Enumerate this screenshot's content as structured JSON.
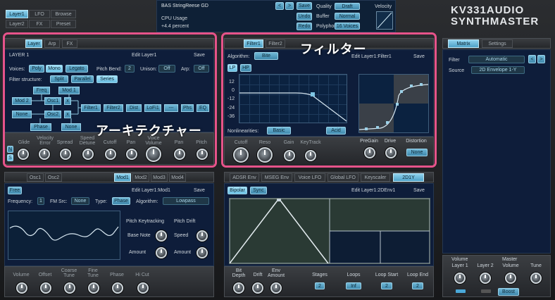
{
  "top": {
    "nav": [
      "Layer1",
      "LFO",
      "Browse",
      "Layer2",
      "FX",
      "Preset"
    ],
    "preset_name": "BAS StringReese GD",
    "cpu_label": "CPU Usage",
    "cpu_value": "+4.4 percent",
    "save": "Save",
    "undo": "Undo",
    "redo": "Redo",
    "quality_label": "Quality",
    "quality_value": "Draft",
    "buffer_label": "Buffer",
    "buffer_value": "Normal",
    "polyphony_label": "Polyphony",
    "polyphony_value": "16 Voices",
    "velocity_label": "Velocity",
    "logo_top": "KV331AUDIO",
    "logo_bottom": "SYNTHMASTER"
  },
  "layer_panel": {
    "tabs": [
      "Layer",
      "Arp",
      "FX"
    ],
    "title": "LAYER 1",
    "edit": "Edit Layer1",
    "save": "Save",
    "voices_label": "Voices:",
    "voices": [
      "Poly",
      "Mono",
      "Legato"
    ],
    "pitchbend_label": "Pitch Bend:",
    "pitchbend_value": "2",
    "unison_label": "Unison:",
    "unison_value": "Off",
    "arp_label": "Arp:",
    "arp_value": "Off",
    "filter_structure_label": "Filter structure:",
    "filter_structure": [
      "Split",
      "Parallel",
      "Series"
    ],
    "routing": {
      "freq": "Freq",
      "mod1": "Mod 1",
      "mod2": "Mod 2",
      "osc1": "Osc1",
      "osc2": "Osc2",
      "none1": "None",
      "phase": "Phase",
      "none2": "None",
      "x": "x",
      "chain": [
        "Filter1",
        "Filter2",
        "Dist",
        "LoFi1",
        "---",
        "Phs",
        "EQ"
      ]
    },
    "knobs": [
      "Glide",
      "Velocity Error",
      "Spread",
      "Speed Detune",
      "Cutoff",
      "Pan",
      "Voice Volume",
      "Pan",
      "Pitch"
    ],
    "ns": [
      "N",
      "S"
    ],
    "annotation": "アーキテクチャー"
  },
  "filter_panel": {
    "tabs": [
      "Filter1",
      "Filter2"
    ],
    "algorithm_label": "Algorithm:",
    "algorithm_value": "Bite",
    "edit": "Edit Layer1:Filter1",
    "save": "Save",
    "modes": [
      "LP",
      "HP"
    ],
    "y_ticks": [
      "12",
      "0",
      "-12",
      "-24",
      "-36"
    ],
    "nonlin_label": "Nonlinearities:",
    "nonlin_value": "Basic",
    "acid": "Acid",
    "knobs": [
      "Cutoff",
      "Reso",
      "Gain",
      "KeyTrack"
    ],
    "dist_knobs": [
      "PreGain",
      "Drive",
      "Distortion"
    ],
    "distortion_value": "None",
    "annotation": "フィルター"
  },
  "matrix_panel": {
    "tabs": [
      "Matrix",
      "Settings"
    ],
    "filter_label": "Filter",
    "filter_value": "Automatic",
    "source_label": "Source",
    "source_value": "2D Envelope 1-Y"
  },
  "mod_panel": {
    "tabs": [
      "Osc1",
      "Osc2",
      "Mod1",
      "Mod2",
      "Mod3",
      "Mod4"
    ],
    "free": "Free",
    "edit": "Edit Layer1:Mod1",
    "save": "Save",
    "frequency_label": "Frequency:",
    "frequency_value": "1",
    "fmsrc_label": "FM Src:",
    "fmsrc_value": "None",
    "type_label": "Type:",
    "type_value": "Phase",
    "algorithm_label": "Algorithm:",
    "algorithm_value": "Lowpass",
    "pitch_kt": "Pitch Keytracking",
    "pitch_drift": "Pitch Drift",
    "base_note": "Base Note",
    "speed": "Speed",
    "amount1": "Amount",
    "amount2": "Amount",
    "knobs": [
      "Volume",
      "Offset",
      "Coarse Tune",
      "Fine Tune",
      "Phase",
      "Hi Cut"
    ]
  },
  "env_panel": {
    "tabs": [
      "ADSR Env",
      "MSEG Env",
      "Voice LFO",
      "Global LFO",
      "Keyscaler",
      "2D1Y"
    ],
    "modes": [
      "Bipolar",
      "Sync"
    ],
    "edit": "Edit Layer1:2DEnv1",
    "save": "Save",
    "knobs": [
      "Bit Depth",
      "Drift",
      "Env Amount"
    ],
    "stages_label": "Stages",
    "stages_value": "2",
    "loops_label": "Loops",
    "loops_value": "Inf",
    "loopstart_label": "Loop Start",
    "loopstart_value": "2",
    "loopend_label": "Loop End",
    "loopend_value": "2"
  },
  "volume_panel": {
    "volume_label": "Volume",
    "master_label": "Master",
    "knobs": [
      "Layer 1",
      "Layer 2",
      "Volume",
      "Tune"
    ],
    "boost": "Boost"
  }
}
